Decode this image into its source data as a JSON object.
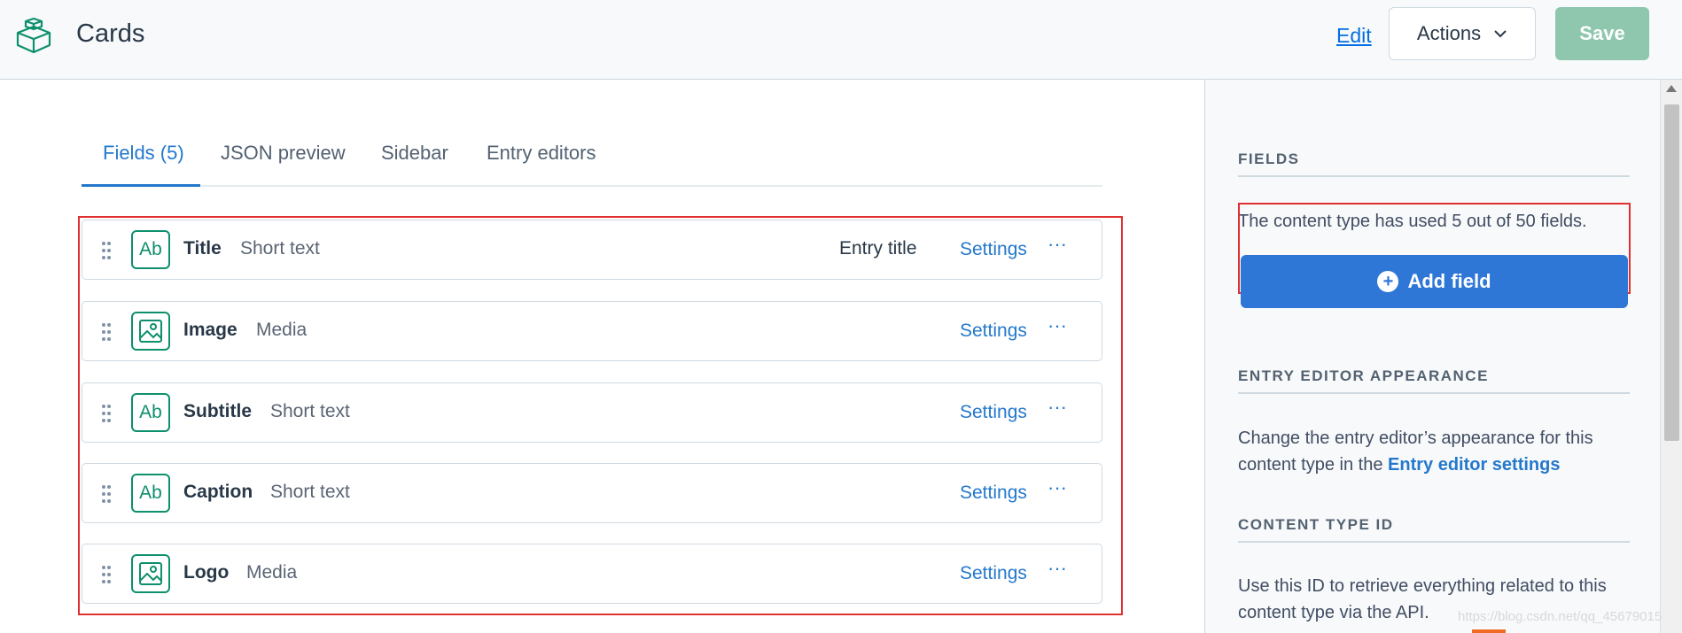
{
  "header": {
    "title": "Cards",
    "logo_icon": "content-type-cube-icon",
    "edit_label": "Edit",
    "actions_label": "Actions",
    "save_label": "Save"
  },
  "tabs": [
    {
      "label": "Fields (5)",
      "active": true
    },
    {
      "label": "JSON preview",
      "active": false
    },
    {
      "label": "Sidebar",
      "active": false
    },
    {
      "label": "Entry editors",
      "active": false
    }
  ],
  "fields": [
    {
      "name": "Title",
      "type": "Short text",
      "icon": "short-text-icon",
      "badge": "Entry title",
      "settings": "Settings"
    },
    {
      "name": "Image",
      "type": "Media",
      "icon": "media-icon",
      "badge": "",
      "settings": "Settings"
    },
    {
      "name": "Subtitle",
      "type": "Short text",
      "icon": "short-text-icon",
      "badge": "",
      "settings": "Settings"
    },
    {
      "name": "Caption",
      "type": "Short text",
      "icon": "short-text-icon",
      "badge": "",
      "settings": "Settings"
    },
    {
      "name": "Logo",
      "type": "Media",
      "icon": "media-icon",
      "badge": "",
      "settings": "Settings"
    }
  ],
  "sidebar": {
    "fields_heading": "FIELDS",
    "fields_text": "The content type has used 5 out of 50 fields.",
    "add_field_label": "Add field",
    "appearance_heading": "ENTRY EDITOR APPEARANCE",
    "appearance_text": "Change the entry editor’s appearance for this content type in the",
    "appearance_link": "Entry editor settings",
    "id_heading": "CONTENT TYPE ID",
    "id_text": "Use this ID to retrieve everything related to this content type via the API."
  },
  "watermark": "https://blog.csdn.net/qq_45679015",
  "colors": {
    "accent": "#2478cc",
    "field_icon": "#0e8f6d",
    "save_disabled": "#8ec7ae",
    "highlight": "#e03030"
  }
}
